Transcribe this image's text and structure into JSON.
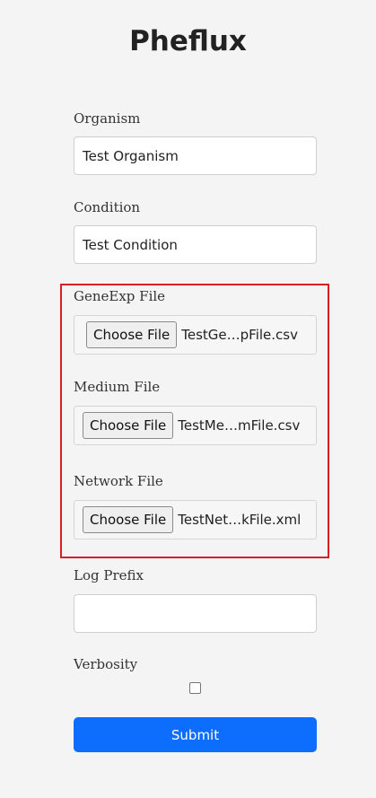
{
  "page": {
    "title": "Pheflux"
  },
  "form": {
    "organism": {
      "label": "Organism",
      "value": "Test Organism"
    },
    "condition": {
      "label": "Condition",
      "value": "Test Condition"
    },
    "geneexp_file": {
      "label": "GeneExp File",
      "button_label": "Choose File",
      "file_name": "TestGe…pFile.csv"
    },
    "medium_file": {
      "label": "Medium File",
      "button_label": "Choose File",
      "file_name": "TestMe…mFile.csv"
    },
    "network_file": {
      "label": "Network File",
      "button_label": "Choose File",
      "file_name": "TestNet…kFile.xml"
    },
    "log_prefix": {
      "label": "Log Prefix",
      "value": ""
    },
    "verbosity": {
      "label": "Verbosity",
      "checked": false
    },
    "submit_label": "Submit"
  },
  "colors": {
    "primary": "#0d6efd",
    "highlight": "#d81f26",
    "background": "#f4f4f4"
  }
}
